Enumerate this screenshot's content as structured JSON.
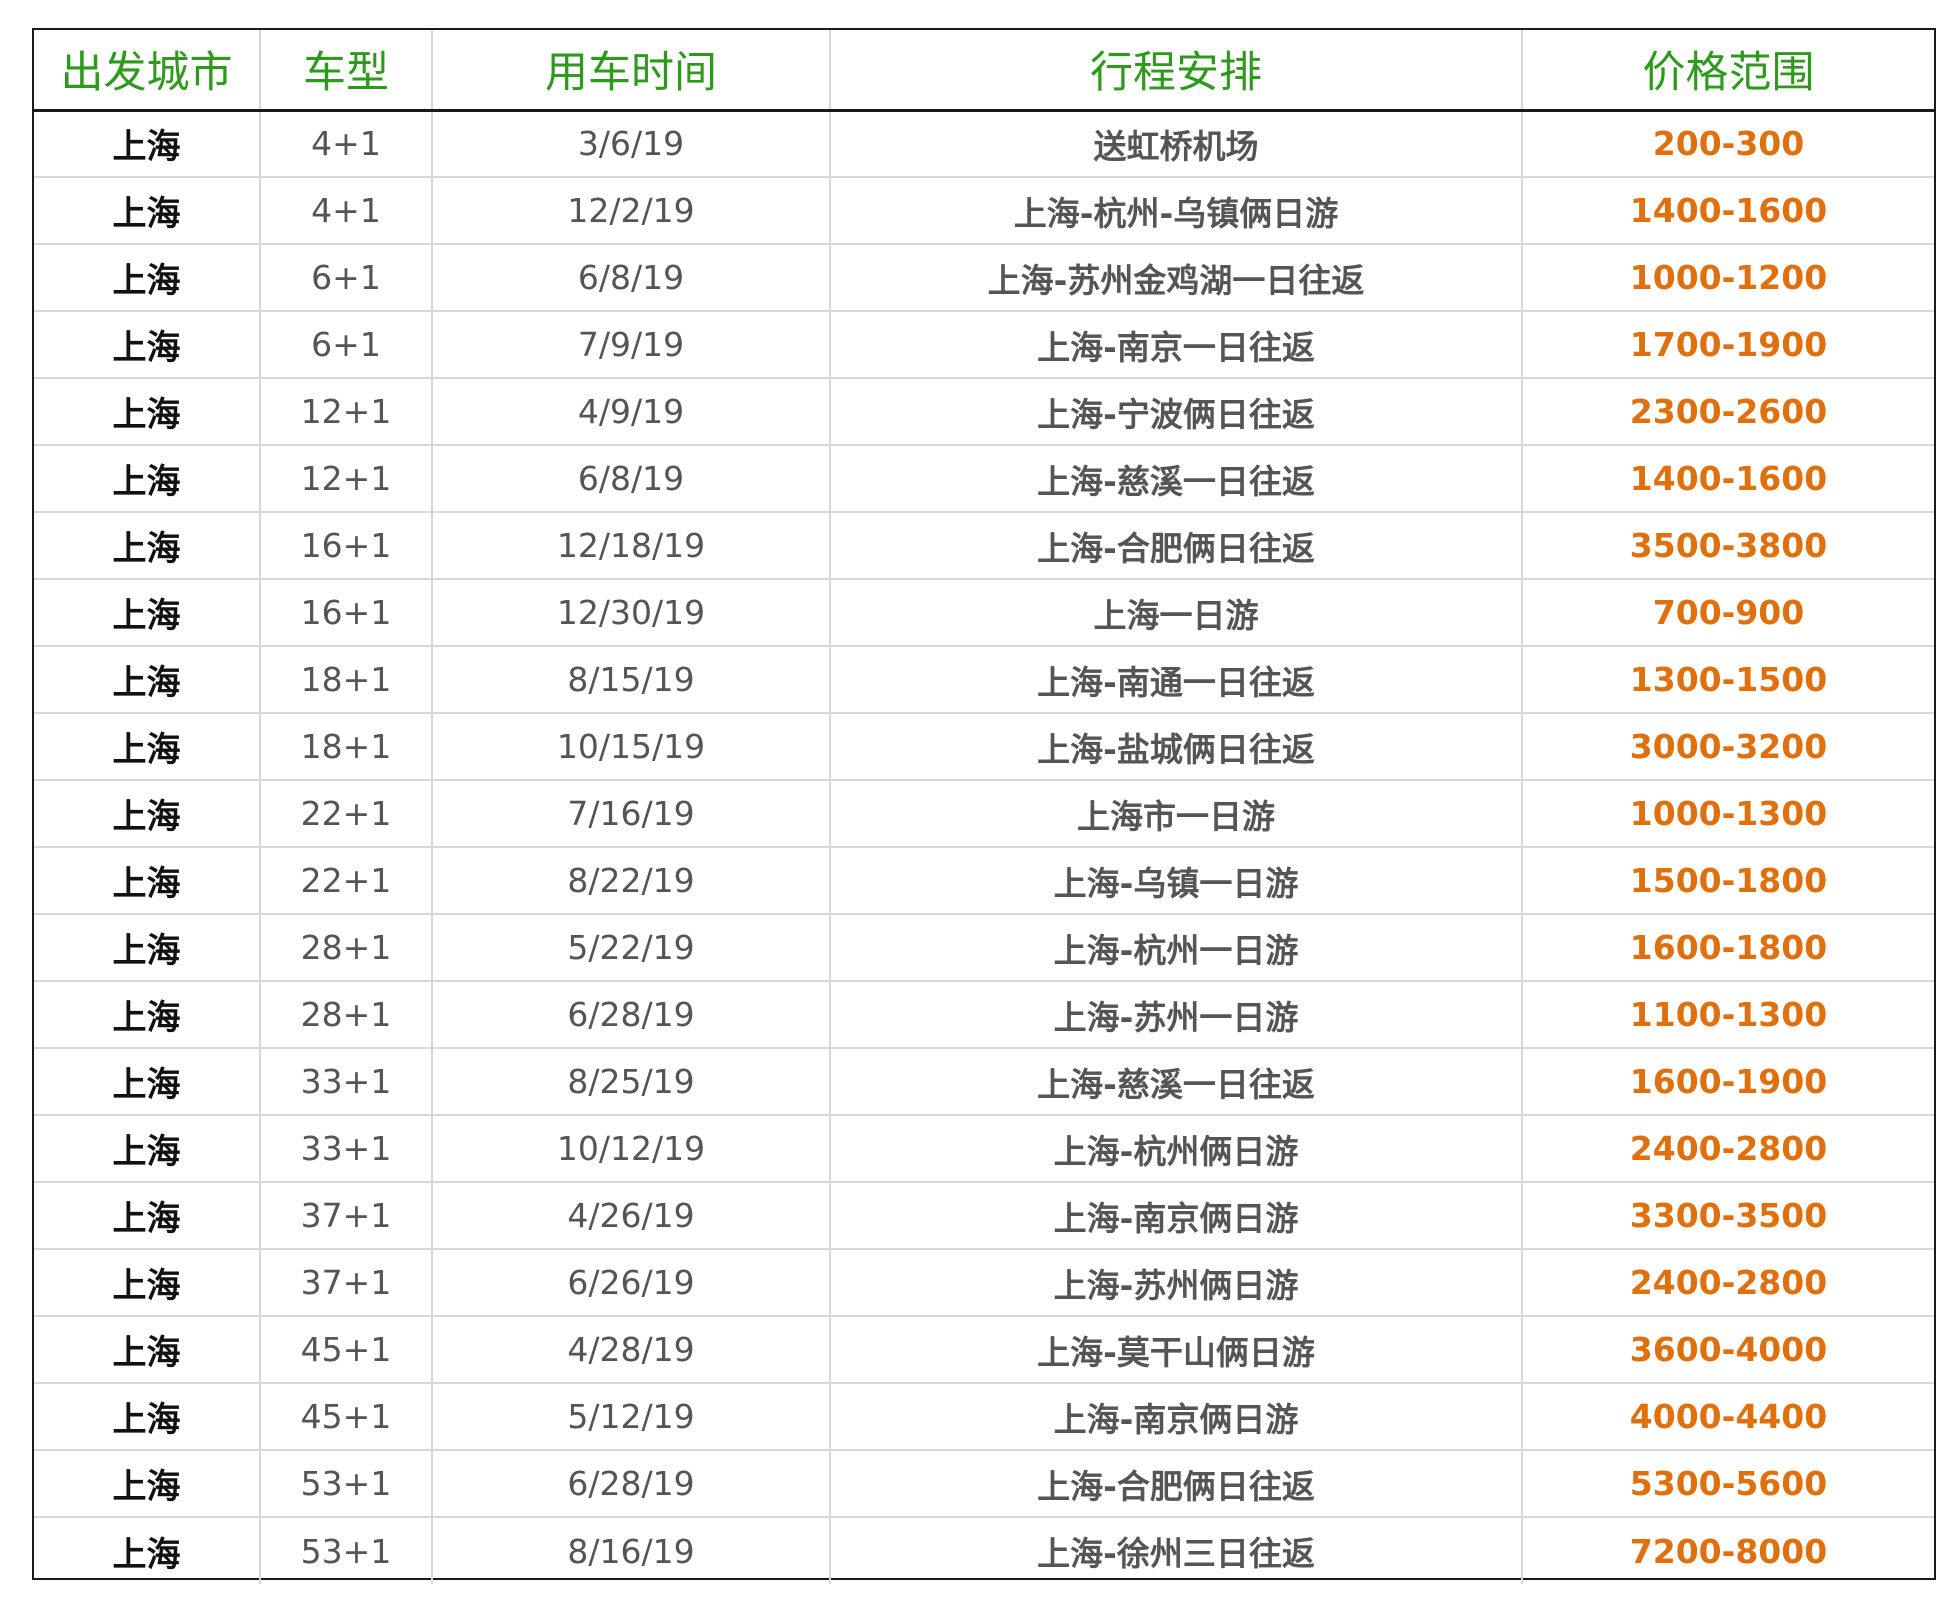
{
  "colors": {
    "header_text": "#2e9a1c",
    "price_text": "#e0700e",
    "city_text": "#111111",
    "body_text": "#555555",
    "border": "#1a1a1a",
    "grid": "#d8d8d8"
  },
  "headers": {
    "city": "出发城市",
    "vehicle": "车型",
    "date": "用车时间",
    "itinerary": "行程安排",
    "price": "价格范围"
  },
  "rows": [
    {
      "city": "上海",
      "vehicle": "4+1",
      "date": "3/6/19",
      "itinerary": "送虹桥机场",
      "price": "200-300"
    },
    {
      "city": "上海",
      "vehicle": "4+1",
      "date": "12/2/19",
      "itinerary": "上海-杭州-乌镇俩日游",
      "price": "1400-1600"
    },
    {
      "city": "上海",
      "vehicle": "6+1",
      "date": "6/8/19",
      "itinerary": "上海-苏州金鸡湖一日往返",
      "price": "1000-1200"
    },
    {
      "city": "上海",
      "vehicle": "6+1",
      "date": "7/9/19",
      "itinerary": "上海-南京一日往返",
      "price": "1700-1900"
    },
    {
      "city": "上海",
      "vehicle": "12+1",
      "date": "4/9/19",
      "itinerary": "上海-宁波俩日往返",
      "price": "2300-2600"
    },
    {
      "city": "上海",
      "vehicle": "12+1",
      "date": "6/8/19",
      "itinerary": "上海-慈溪一日往返",
      "price": "1400-1600"
    },
    {
      "city": "上海",
      "vehicle": "16+1",
      "date": "12/18/19",
      "itinerary": "上海-合肥俩日往返",
      "price": "3500-3800"
    },
    {
      "city": "上海",
      "vehicle": "16+1",
      "date": "12/30/19",
      "itinerary": "上海一日游",
      "price": "700-900"
    },
    {
      "city": "上海",
      "vehicle": "18+1",
      "date": "8/15/19",
      "itinerary": "上海-南通一日往返",
      "price": "1300-1500"
    },
    {
      "city": "上海",
      "vehicle": "18+1",
      "date": "10/15/19",
      "itinerary": "上海-盐城俩日往返",
      "price": "3000-3200"
    },
    {
      "city": "上海",
      "vehicle": "22+1",
      "date": "7/16/19",
      "itinerary": "上海市一日游",
      "price": "1000-1300"
    },
    {
      "city": "上海",
      "vehicle": "22+1",
      "date": "8/22/19",
      "itinerary": "上海-乌镇一日游",
      "price": "1500-1800"
    },
    {
      "city": "上海",
      "vehicle": "28+1",
      "date": "5/22/19",
      "itinerary": "上海-杭州一日游",
      "price": "1600-1800"
    },
    {
      "city": "上海",
      "vehicle": "28+1",
      "date": "6/28/19",
      "itinerary": "上海-苏州一日游",
      "price": "1100-1300"
    },
    {
      "city": "上海",
      "vehicle": "33+1",
      "date": "8/25/19",
      "itinerary": "上海-慈溪一日往返",
      "price": "1600-1900"
    },
    {
      "city": "上海",
      "vehicle": "33+1",
      "date": "10/12/19",
      "itinerary": "上海-杭州俩日游",
      "price": "2400-2800"
    },
    {
      "city": "上海",
      "vehicle": "37+1",
      "date": "4/26/19",
      "itinerary": "上海-南京俩日游",
      "price": "3300-3500"
    },
    {
      "city": "上海",
      "vehicle": "37+1",
      "date": "6/26/19",
      "itinerary": "上海-苏州俩日游",
      "price": "2400-2800"
    },
    {
      "city": "上海",
      "vehicle": "45+1",
      "date": "4/28/19",
      "itinerary": "上海-莫干山俩日游",
      "price": "3600-4000"
    },
    {
      "city": "上海",
      "vehicle": "45+1",
      "date": "5/12/19",
      "itinerary": "上海-南京俩日游",
      "price": "4000-4400"
    },
    {
      "city": "上海",
      "vehicle": "53+1",
      "date": "6/28/19",
      "itinerary": "上海-合肥俩日往返",
      "price": "5300-5600"
    },
    {
      "city": "上海",
      "vehicle": "53+1",
      "date": "8/16/19",
      "itinerary": "上海-徐州三日往返",
      "price": "7200-8000"
    }
  ]
}
